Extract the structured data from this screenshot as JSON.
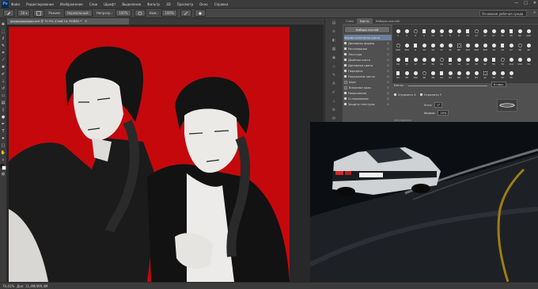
{
  "menubar": {
    "logo": "Ps",
    "items": [
      "Файл",
      "Редактирование",
      "Изображение",
      "Слои",
      "Шрифт",
      "Выделение",
      "Фильтр",
      "3D",
      "Просмотр",
      "Окно",
      "Справка"
    ],
    "window_controls": [
      "—",
      "□",
      "✕"
    ]
  },
  "options": {
    "brush_size": "18",
    "mode_label": "Режим:",
    "mode_value": "Нормальный",
    "opacity_label": "Непрозр.:",
    "opacity_value": "100%",
    "flow_label": "Наж.:",
    "flow_value": "100%",
    "workspace": "Основная рабочая среда"
  },
  "document": {
    "tab_title": "ggggggggggggg.psd @ 70.5% (Слой 14, RGB/8) *",
    "tab_close": "✕"
  },
  "statusbar": {
    "zoom": "70,41%",
    "doc_info": "Док: 11,4M/499,4M"
  },
  "panel": {
    "tabs": [
      "Слои",
      "Кисть",
      "Наборы кистей"
    ],
    "active_tab": "Кисть",
    "preset_button": "Наборы кистей",
    "list_header": "Форма отпечатка кисти",
    "list_items": [
      {
        "label": "Динамика формы",
        "checked": true
      },
      {
        "label": "Рассеивание",
        "checked": true
      },
      {
        "label": "Текстура",
        "checked": true
      },
      {
        "label": "Двойная кисть",
        "checked": true
      },
      {
        "label": "Динамика цвета",
        "checked": true
      },
      {
        "label": "Передача",
        "checked": true
      },
      {
        "label": "Положение кисти",
        "checked": true
      },
      {
        "label": "Шум",
        "checked": false
      },
      {
        "label": "Влажные края",
        "checked": false
      },
      {
        "label": "Накопление",
        "checked": true
      },
      {
        "label": "Сглаживание",
        "checked": true
      },
      {
        "label": "Защита текстуры",
        "checked": true
      }
    ],
    "preset_sizes": [
      "1",
      "3",
      "5",
      "9",
      "13",
      "19",
      "5",
      "9",
      "13",
      "17",
      "21",
      "27",
      "35",
      "45",
      "65",
      "100",
      "200",
      "300",
      "9",
      "13",
      "19",
      "17",
      "45",
      "65",
      "100",
      "200",
      "300",
      "14",
      "24",
      "27",
      "39",
      "46",
      "59",
      "11",
      "17",
      "23",
      "36",
      "44",
      "60",
      "14",
      "26",
      "33",
      "42",
      "55",
      "70",
      "112",
      "134",
      "74",
      "95",
      "29",
      "192",
      "36",
      "36",
      "33",
      "63",
      "66",
      "39",
      "63",
      "11",
      "48",
      "32",
      "55"
    ],
    "size_label": "Кегль",
    "size_value": "6 пикс.",
    "flip_x_label": "Отразить X",
    "flip_y_label": "Отразить Y",
    "angle_label": "Угол:",
    "angle_value": "0°",
    "roundness_label": "Форма:",
    "roundness_value": "20%",
    "spacing_label": "Интервалы"
  }
}
